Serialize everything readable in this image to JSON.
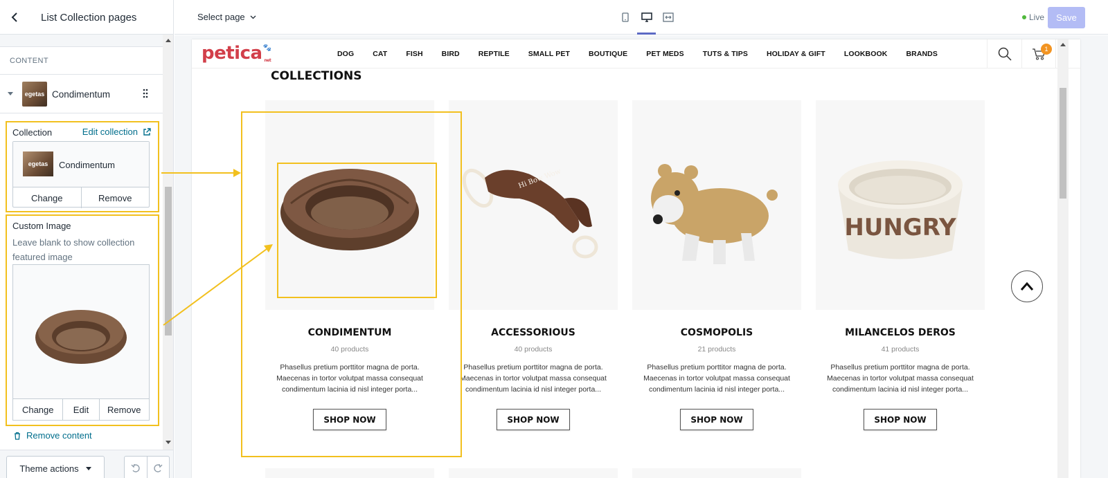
{
  "sidebar": {
    "title": "List Collection pages",
    "section_label": "CONTENT",
    "block": {
      "name": "Condimentum",
      "thumb_text": "egetas"
    },
    "collection_field": {
      "label": "Collection",
      "edit_link": "Edit collection",
      "value": "Condimentum",
      "thumb_text": "egetas",
      "buttons": {
        "change": "Change",
        "remove": "Remove"
      }
    },
    "image_field": {
      "label": "Custom Image",
      "help": "Leave blank to show collection featured image",
      "buttons": {
        "change": "Change",
        "edit": "Edit",
        "remove": "Remove"
      }
    },
    "remove_content": "Remove content",
    "theme_actions": "Theme actions"
  },
  "topbar": {
    "select_page": "Select page",
    "live": "Live",
    "save": "Save"
  },
  "store": {
    "logo": "petica",
    "logo_suffix": "net",
    "nav": [
      "DOG",
      "CAT",
      "FISH",
      "BIRD",
      "REPTILE",
      "SMALL PET",
      "BOUTIQUE",
      "PET MEDS",
      "TUTS & TIPS",
      "HOLIDAY & GIFT",
      "LOOKBOOK",
      "BRANDS"
    ],
    "cart_count": "1",
    "section_title": "COLLECTIONS",
    "collections": [
      {
        "title": "CONDIMENTUM",
        "count": "40 products",
        "desc": "Phasellus pretium porttitor magna de porta. Maecenas in tortor volutpat massa consequat condimentum lacinia id nisl integer porta...",
        "cta": "SHOP NOW",
        "image": "pet-bed"
      },
      {
        "title": "ACCESSORIOUS",
        "count": "40 products",
        "desc": "Phasellus pretium porttitor magna de porta. Maecenas in tortor volutpat massa consequat condimentum lacinia id nisl integer porta...",
        "cta": "SHOP NOW",
        "image": "rope-toy"
      },
      {
        "title": "COSMOPOLIS",
        "count": "21 products",
        "desc": "Phasellus pretium porttitor magna de porta. Maecenas in tortor volutpat massa consequat condimentum lacinia id nisl integer porta...",
        "cta": "SHOP NOW",
        "image": "dog-costume"
      },
      {
        "title": "MILANCELOS DEROS",
        "count": "41 products",
        "desc": "Phasellus pretium porttitor magna de porta. Maecenas in tortor volutpat massa consequat condimentum lacinia id nisl integer porta...",
        "cta": "SHOP NOW",
        "image": "food-bowl",
        "bowl_text": "HUNGRY"
      }
    ]
  },
  "colors": {
    "accent": "#5c6ac4",
    "annotation": "#f2c01e",
    "link": "#006e8c",
    "logo": "#d23f4a",
    "badge": "#f29422"
  }
}
